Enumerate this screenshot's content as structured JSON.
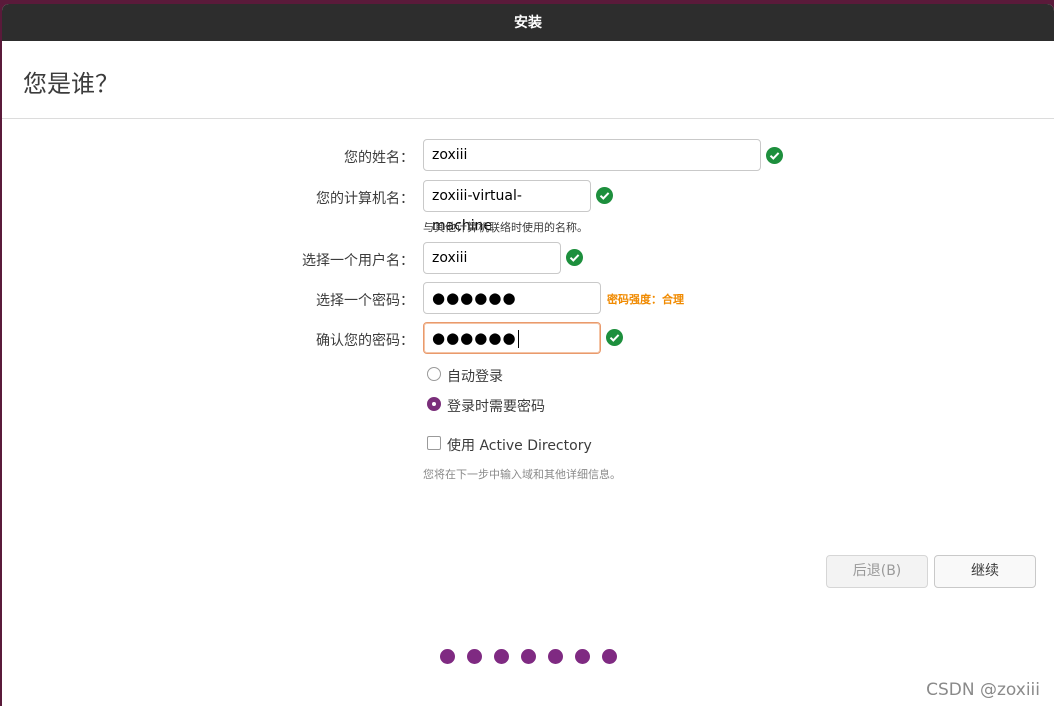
{
  "window": {
    "title": "安装"
  },
  "page": {
    "title": "您是谁？"
  },
  "form": {
    "name": {
      "label": "您的姓名：",
      "value": "zoxiii",
      "valid": true
    },
    "computer": {
      "label": "您的计算机名：",
      "value": "zoxiii-virtual-machine",
      "hint": "与其他计算机联络时使用的名称。",
      "valid": true
    },
    "username": {
      "label": "选择一个用户名：",
      "value": "zoxiii",
      "valid": true
    },
    "password": {
      "label": "选择一个密码：",
      "masked": "●●●●●●",
      "strength": "密码强度：合理"
    },
    "confirm": {
      "label": "确认您的密码：",
      "masked": "●●●●●●",
      "valid": true
    }
  },
  "login_options": {
    "auto_login": {
      "label": "自动登录",
      "selected": false
    },
    "require_password": {
      "label": "登录时需要密码",
      "selected": true
    }
  },
  "active_directory": {
    "label": "使用 Active Directory",
    "checked": false,
    "hint": "您将在下一步中输入域和其他详细信息。"
  },
  "buttons": {
    "back": "后退(B)",
    "continue": "继续"
  },
  "progress": {
    "steps": 7,
    "accent": "#7f2a82"
  },
  "colors": {
    "valid": "#1d8f3d",
    "strength": "#f08a00"
  },
  "watermark": "CSDN @zoxiii"
}
